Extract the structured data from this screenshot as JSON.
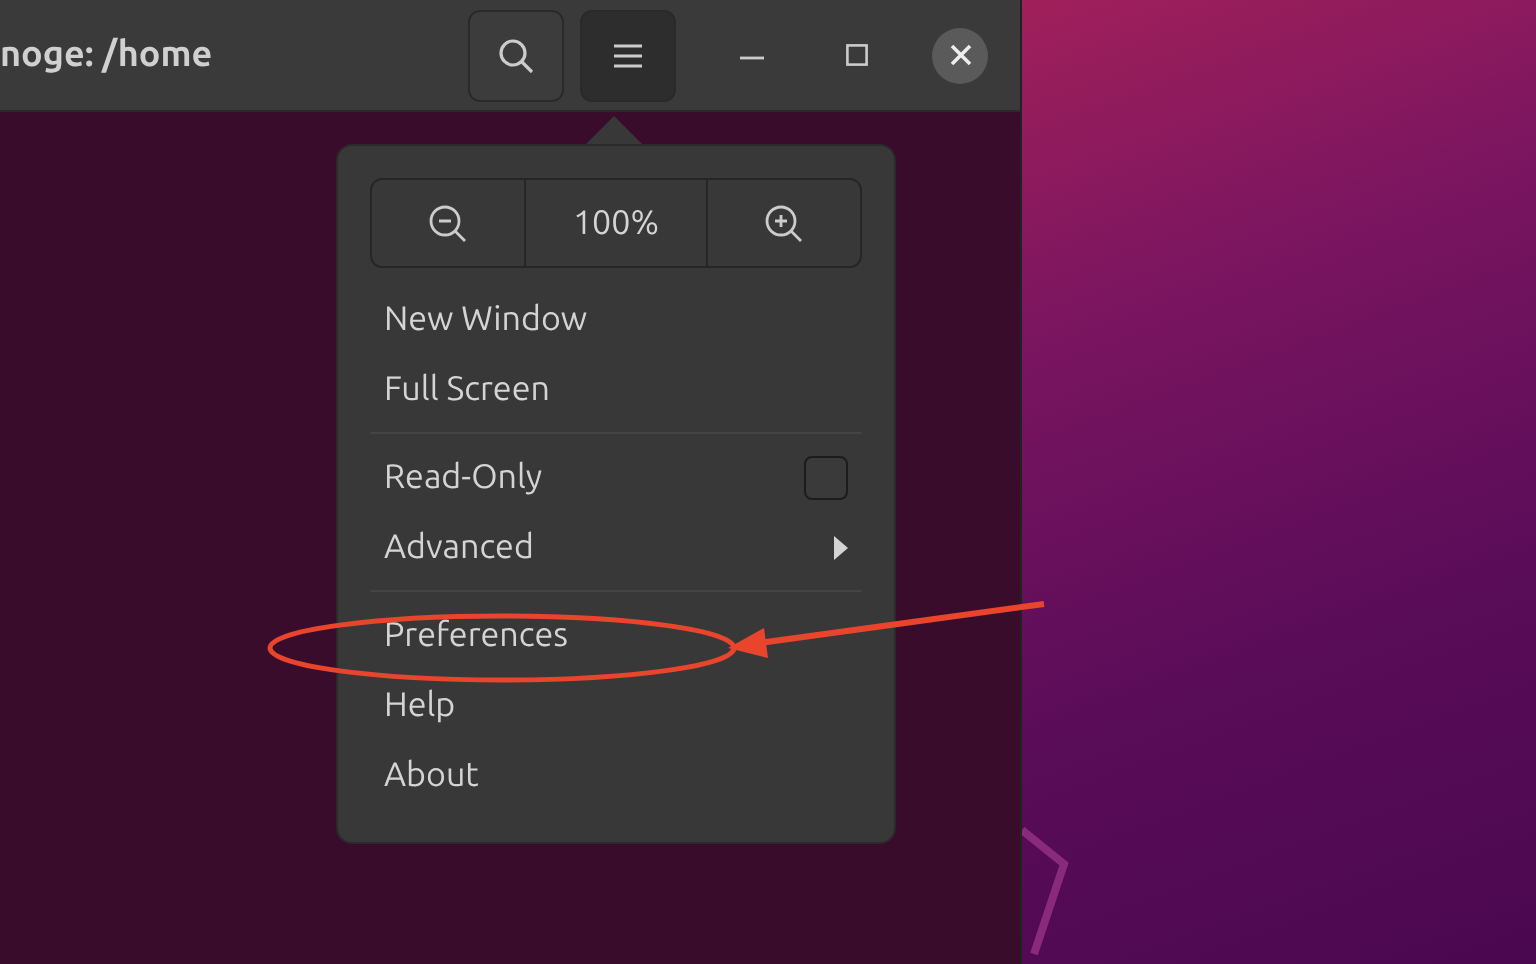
{
  "window": {
    "title": "noge: /home",
    "menu_button": {
      "active": true
    }
  },
  "menu": {
    "zoom": {
      "level_text": "100%"
    },
    "sections": [
      [
        {
          "kind": "item",
          "label": "New Window"
        },
        {
          "kind": "item",
          "label": "Full Screen"
        }
      ],
      [
        {
          "kind": "checkbox",
          "label": "Read-Only",
          "checked": false
        },
        {
          "kind": "submenu",
          "label": "Advanced"
        }
      ],
      [
        {
          "kind": "item",
          "label": "Preferences"
        },
        {
          "kind": "item",
          "label": "Help"
        },
        {
          "kind": "item",
          "label": "About"
        }
      ]
    ]
  }
}
